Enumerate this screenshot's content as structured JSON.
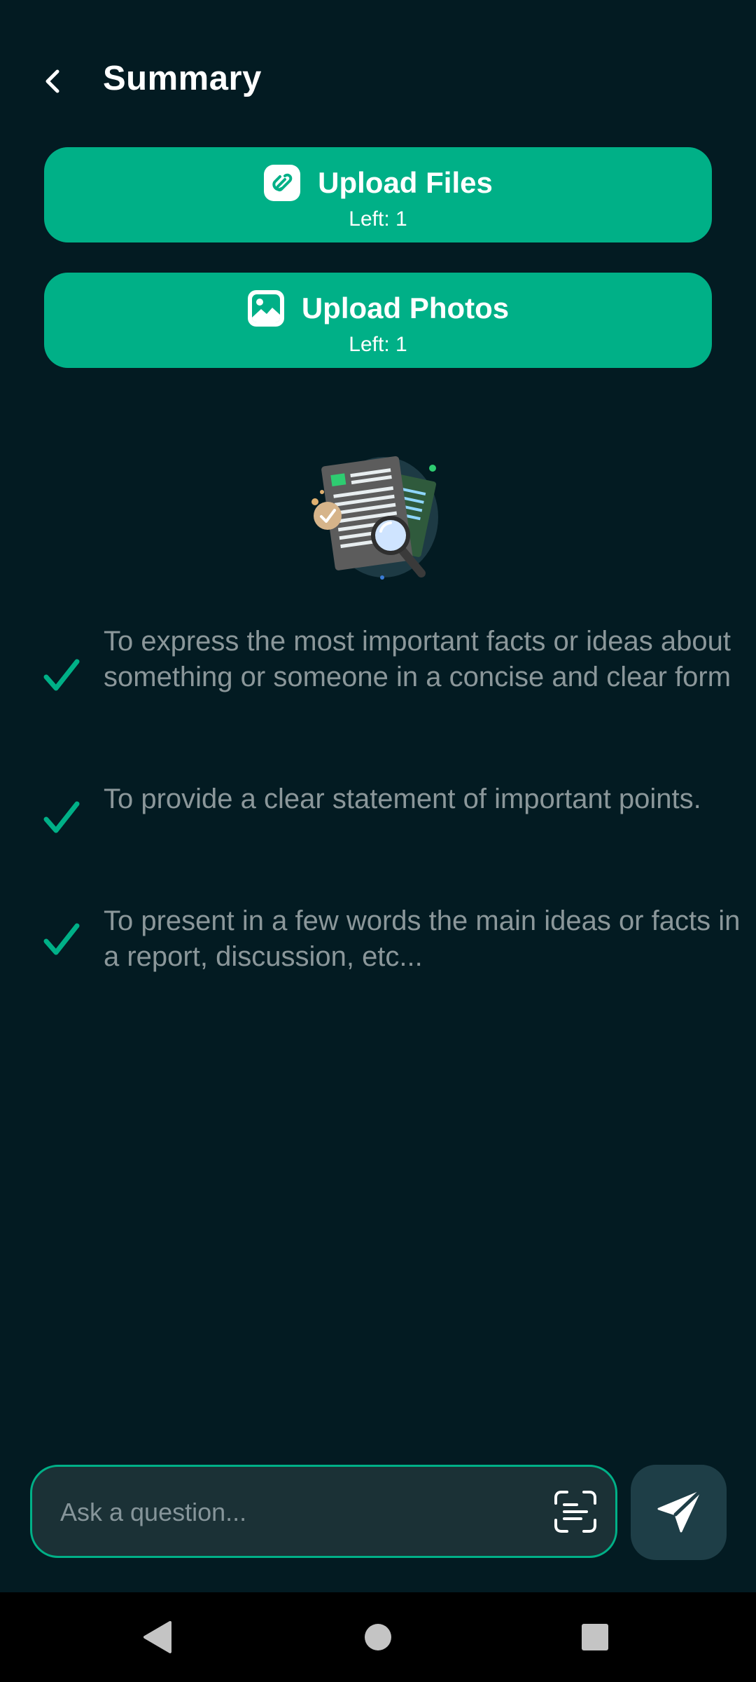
{
  "header": {
    "title": "Summary",
    "back_icon": "chevron-left-icon"
  },
  "upload_files": {
    "label": "Upload Files",
    "left_text": "Left: 1",
    "icon": "paperclip-icon"
  },
  "upload_photos": {
    "label": "Upload Photos",
    "left_text": "Left: 1",
    "icon": "image-icon"
  },
  "illustration": {
    "icon": "document-magnifier-illustration"
  },
  "bullets": [
    {
      "text": "To express the most important facts or ideas about something or someone in a concise and clear form"
    },
    {
      "text": "To provide a clear statement of important points."
    },
    {
      "text": "To present in a few words the main ideas or facts in a report, discussion, etc..."
    }
  ],
  "ask": {
    "placeholder": "Ask a question...",
    "value": "",
    "scan_icon": "text-scan-icon",
    "send_icon": "send-icon"
  },
  "system_nav": {
    "back_icon": "nav-back-triangle-icon",
    "home_icon": "nav-home-circle-icon",
    "recents_icon": "nav-recents-square-icon"
  },
  "colors": {
    "background": "#031b22",
    "accent": "#00b087",
    "muted_text": "#8b979a",
    "input_background": "#1b3136",
    "send_button": "#1e3e47"
  }
}
